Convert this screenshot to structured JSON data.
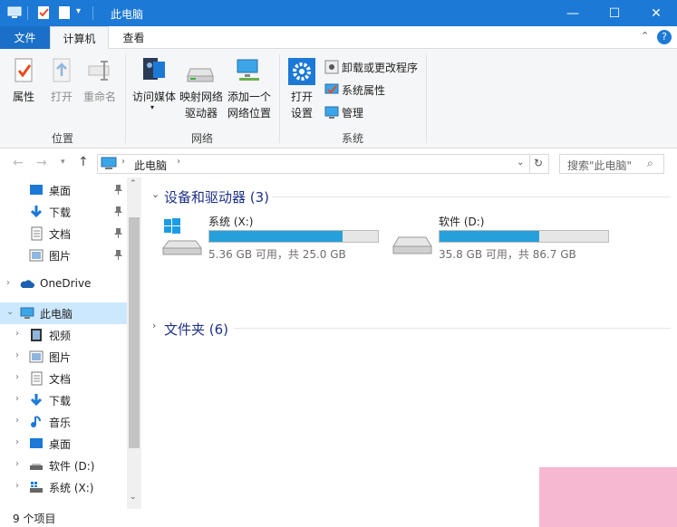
{
  "window": {
    "title": "此电脑",
    "minimize": "—",
    "maximize": "☐",
    "close": "✕"
  },
  "tabs": {
    "file": "文件",
    "computer": "计算机",
    "view": "查看"
  },
  "ribbon": {
    "location_group": {
      "label": "位置",
      "properties": "属性",
      "open": "打开",
      "rename": "重命名"
    },
    "network_group": {
      "label": "网络",
      "access_media": "访问媒体",
      "map_drive_1": "映射网络",
      "map_drive_2": "驱动器",
      "add_location_1": "添加一个",
      "add_location_2": "网络位置"
    },
    "system_group": {
      "label": "系统",
      "open_settings_1": "打开",
      "open_settings_2": "设置",
      "uninstall": "卸载或更改程序",
      "system_properties": "系统属性",
      "manage": "管理"
    }
  },
  "address": {
    "path": "此电脑",
    "search_placeholder": "搜索\"此电脑\""
  },
  "nav": {
    "quick": [
      {
        "label": "桌面",
        "icon": "desktop-icon"
      },
      {
        "label": "下载",
        "icon": "download-icon"
      },
      {
        "label": "文档",
        "icon": "document-icon"
      },
      {
        "label": "图片",
        "icon": "picture-icon"
      }
    ],
    "onedrive": "OneDrive",
    "thispc": "此电脑",
    "children": [
      {
        "label": "视频",
        "icon": "video-icon"
      },
      {
        "label": "图片",
        "icon": "picture-icon"
      },
      {
        "label": "文档",
        "icon": "document-icon"
      },
      {
        "label": "下载",
        "icon": "download-icon"
      },
      {
        "label": "音乐",
        "icon": "music-icon"
      },
      {
        "label": "桌面",
        "icon": "desktop-icon"
      },
      {
        "label": "软件 (D:)",
        "icon": "drive-icon"
      },
      {
        "label": "系统 (X:)",
        "icon": "system-drive-icon"
      }
    ]
  },
  "content": {
    "devices_title": "设备和驱动器 (3)",
    "folders_title": "文件夹 (6)",
    "drives": [
      {
        "name": "系统 (X:)",
        "detail": "5.36 GB 可用，共 25.0 GB",
        "used_fraction": 0.79
      },
      {
        "name": "软件 (D:)",
        "detail": "35.8 GB 可用，共 86.7 GB",
        "used_fraction": 0.59
      }
    ]
  },
  "status": {
    "count": "9 个项目"
  },
  "colors": {
    "accent": "#1c79d6",
    "bar_fill": "#26a0da",
    "section_title": "#1e3287"
  }
}
